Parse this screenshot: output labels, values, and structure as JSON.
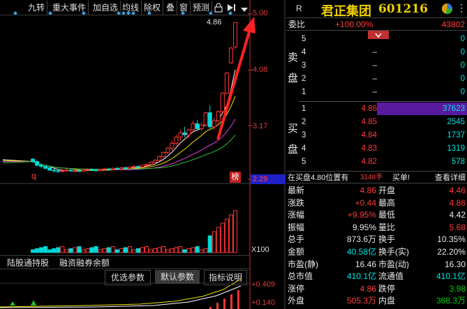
{
  "toolbar": {
    "items": [
      "九转",
      "重大事件",
      "加自选",
      "均线",
      "除权",
      "叠",
      "窗",
      "预测"
    ],
    "lock_icon": "lock-icon",
    "jump_icon": "jump-to-end-icon",
    "menu_icon": "dropdown-arrow-icon"
  },
  "chart": {
    "price_axis": [
      "5.00",
      "4.08",
      "3.17",
      "2.29"
    ],
    "last_price_label": "4.86",
    "low_marker": "q",
    "bang_badge": "榜",
    "volume_scale": "X100",
    "indicator_axis": [
      "0.409",
      "0.140"
    ],
    "colors": {
      "up": "#ff3333",
      "down": "#00d8d8",
      "accent": "#ff2222"
    }
  },
  "chart_data": {
    "type": "candlestick",
    "ylim": [
      2.29,
      5.0
    ],
    "y_ticks": [
      5.0,
      4.08,
      3.17,
      2.29
    ],
    "note_last": 4.86,
    "candles": [
      {
        "o": 2.62,
        "h": 2.64,
        "l": 2.56,
        "c": 2.58
      },
      {
        "o": 2.58,
        "h": 2.6,
        "l": 2.5,
        "c": 2.52
      },
      {
        "o": 2.52,
        "h": 2.55,
        "l": 2.47,
        "c": 2.5
      },
      {
        "o": 2.5,
        "h": 2.52,
        "l": 2.45,
        "c": 2.47
      },
      {
        "o": 2.48,
        "h": 2.5,
        "l": 2.42,
        "c": 2.44
      },
      {
        "o": 2.44,
        "h": 2.47,
        "l": 2.4,
        "c": 2.43
      },
      {
        "o": 2.43,
        "h": 2.46,
        "l": 2.39,
        "c": 2.42
      },
      {
        "o": 2.42,
        "h": 2.45,
        "l": 2.4,
        "c": 2.43
      },
      {
        "o": 2.43,
        "h": 2.46,
        "l": 2.41,
        "c": 2.44
      },
      {
        "o": 2.44,
        "h": 2.46,
        "l": 2.41,
        "c": 2.43
      },
      {
        "o": 2.43,
        "h": 2.45,
        "l": 2.41,
        "c": 2.43
      },
      {
        "o": 2.43,
        "h": 2.45,
        "l": 2.41,
        "c": 2.42
      },
      {
        "o": 2.42,
        "h": 2.46,
        "l": 2.41,
        "c": 2.44
      },
      {
        "o": 2.44,
        "h": 2.47,
        "l": 2.42,
        "c": 2.45
      },
      {
        "o": 2.45,
        "h": 2.47,
        "l": 2.43,
        "c": 2.44
      },
      {
        "o": 2.44,
        "h": 2.46,
        "l": 2.42,
        "c": 2.43
      },
      {
        "o": 2.43,
        "h": 2.46,
        "l": 2.42,
        "c": 2.45
      },
      {
        "o": 2.45,
        "h": 2.48,
        "l": 2.43,
        "c": 2.46
      },
      {
        "o": 2.46,
        "h": 2.48,
        "l": 2.44,
        "c": 2.45
      },
      {
        "o": 2.45,
        "h": 2.48,
        "l": 2.44,
        "c": 2.47
      },
      {
        "o": 2.47,
        "h": 2.49,
        "l": 2.45,
        "c": 2.46
      },
      {
        "o": 2.46,
        "h": 2.49,
        "l": 2.45,
        "c": 2.48
      },
      {
        "o": 2.48,
        "h": 2.5,
        "l": 2.46,
        "c": 2.47
      },
      {
        "o": 2.47,
        "h": 2.5,
        "l": 2.46,
        "c": 2.49
      },
      {
        "o": 2.49,
        "h": 2.52,
        "l": 2.47,
        "c": 2.5
      },
      {
        "o": 2.5,
        "h": 2.52,
        "l": 2.48,
        "c": 2.49
      },
      {
        "o": 2.49,
        "h": 2.53,
        "l": 2.48,
        "c": 2.52
      },
      {
        "o": 2.52,
        "h": 2.55,
        "l": 2.5,
        "c": 2.53
      },
      {
        "o": 2.53,
        "h": 2.58,
        "l": 2.52,
        "c": 2.57
      },
      {
        "o": 2.57,
        "h": 2.62,
        "l": 2.55,
        "c": 2.6
      },
      {
        "o": 2.6,
        "h": 2.68,
        "l": 2.58,
        "c": 2.66
      },
      {
        "o": 2.66,
        "h": 2.75,
        "l": 2.64,
        "c": 2.73
      },
      {
        "o": 2.73,
        "h": 2.82,
        "l": 2.7,
        "c": 2.8
      },
      {
        "o": 2.8,
        "h": 2.92,
        "l": 2.76,
        "c": 2.88
      },
      {
        "o": 2.88,
        "h": 3.02,
        "l": 2.84,
        "c": 2.98
      },
      {
        "o": 2.98,
        "h": 3.1,
        "l": 2.92,
        "c": 3.05
      },
      {
        "o": 3.05,
        "h": 3.15,
        "l": 2.98,
        "c": 3.02
      },
      {
        "o": 3.02,
        "h": 3.12,
        "l": 2.97,
        "c": 3.1
      },
      {
        "o": 3.1,
        "h": 3.25,
        "l": 3.05,
        "c": 3.2
      },
      {
        "o": 3.2,
        "h": 3.26,
        "l": 3.08,
        "c": 3.12
      },
      {
        "o": 3.12,
        "h": 3.22,
        "l": 3.08,
        "c": 3.18
      },
      {
        "o": 3.18,
        "h": 3.4,
        "l": 3.15,
        "c": 3.38
      },
      {
        "o": 3.38,
        "h": 3.5,
        "l": 3.12,
        "c": 3.15
      },
      {
        "o": 3.15,
        "h": 3.3,
        "l": 3.1,
        "c": 3.25
      },
      {
        "o": 3.25,
        "h": 3.42,
        "l": 3.2,
        "c": 3.4
      },
      {
        "o": 3.4,
        "h": 3.72,
        "l": 3.38,
        "c": 3.7
      },
      {
        "o": 3.7,
        "h": 4.05,
        "l": 3.68,
        "c": 4.03
      },
      {
        "o": 4.2,
        "h": 4.46,
        "l": 4.18,
        "c": 4.44
      },
      {
        "o": 4.46,
        "h": 4.86,
        "l": 4.42,
        "c": 4.86
      }
    ]
  },
  "panel_tabs": {
    "tab1": "陆股通持股",
    "tab2": "融资融券余额",
    "params1": "优选参数",
    "params2": "默认参数",
    "explain": "指标说明"
  },
  "quote": {
    "r_badge": "R",
    "title": "君正集团",
    "code": "601216",
    "weibi_label": "委比",
    "weibi_value": "+100.00%",
    "weicha_value": "43802",
    "sell_label": [
      "卖",
      "盘"
    ],
    "buy_label": [
      "买",
      "盘"
    ],
    "sell": [
      {
        "level": "5",
        "price": "",
        "vol": "0"
      },
      {
        "level": "4",
        "price": "–",
        "vol": "0"
      },
      {
        "level": "3",
        "price": "–",
        "vol": "0"
      },
      {
        "level": "2",
        "price": "–",
        "vol": "0"
      },
      {
        "level": "1",
        "price": "–",
        "vol": "0"
      }
    ],
    "buy": [
      {
        "level": "1",
        "price": "4.86",
        "vol": "37623"
      },
      {
        "level": "2",
        "price": "4.85",
        "vol": "2545"
      },
      {
        "level": "3",
        "price": "4.84",
        "vol": "1737"
      },
      {
        "level": "4",
        "price": "4.83",
        "vol": "1319"
      },
      {
        "level": "5",
        "price": "4.82",
        "vol": "578"
      }
    ],
    "status_text": "在买盘4.80位置有",
    "status_vol": "3148手",
    "status_action": "买单!",
    "detail_link": "查看详细",
    "stats": [
      {
        "l1": "最新",
        "v1": "4.86",
        "c1": "red",
        "l2": "开盘",
        "v2": "4.46",
        "c2": "red"
      },
      {
        "l1": "涨跌",
        "v1": "+0.44",
        "c1": "red",
        "l2": "最高",
        "v2": "4.86",
        "c2": "red"
      },
      {
        "l1": "涨幅",
        "v1": "+9.95%",
        "c1": "red",
        "l2": "最低",
        "v2": "4.42",
        "c2": "white"
      },
      {
        "l1": "振幅",
        "v1": "9.95%",
        "c1": "white",
        "l2": "量比",
        "v2": "5.68",
        "c2": "red"
      },
      {
        "l1": "总手",
        "v1": "873.6万",
        "c1": "white",
        "l2": "换手",
        "v2": "10.35%",
        "c2": "white"
      },
      {
        "l1": "金额",
        "v1": "40.58亿",
        "c1": "cyan",
        "l2": "换手(实)",
        "v2": "22.20%",
        "c2": "white"
      },
      {
        "l1": "市盈(静)",
        "v1": "16.46",
        "c1": "white",
        "l2": "市盈(动)",
        "v2": "16.30",
        "c2": "white"
      },
      {
        "l1": "总市值",
        "v1": "410.1亿",
        "c1": "cyan",
        "l2": "流通值",
        "v2": "410.1亿",
        "c2": "cyan"
      },
      {
        "l1": "涨停",
        "v1": "4.86",
        "c1": "red",
        "l2": "跌停",
        "v2": "3.98",
        "c2": "green"
      },
      {
        "l1": "外盘",
        "v1": "505.3万",
        "c1": "red",
        "l2": "内盘",
        "v2": "368.3万",
        "c2": "green"
      }
    ]
  }
}
